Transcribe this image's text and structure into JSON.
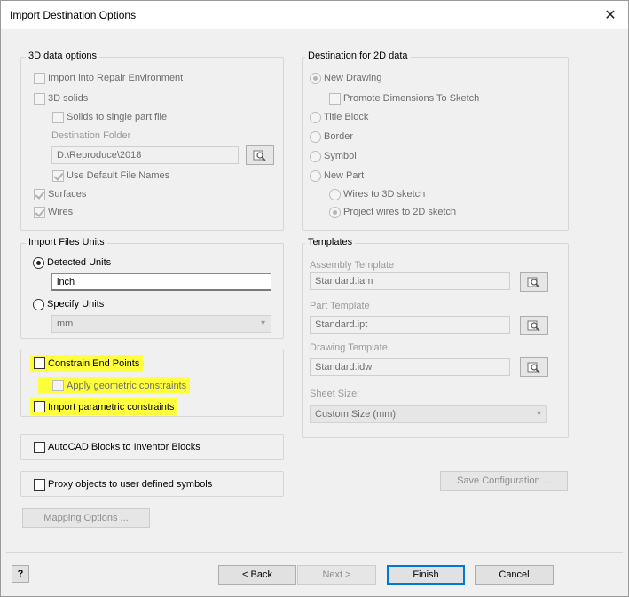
{
  "window": {
    "title": "Import Destination Options",
    "close_glyph": "✕"
  },
  "data_3d": {
    "label": "3D data options",
    "import_repair": "Import into Repair Environment",
    "solids_3d": "3D solids",
    "solids_single": "Solids to single part file",
    "dest_folder_label": "Destination Folder",
    "dest_folder_value": "D:\\Reproduce\\2018",
    "use_default_names": "Use Default File Names",
    "surfaces": "Surfaces",
    "wires": "Wires"
  },
  "dest_2d": {
    "label": "Destination for 2D data",
    "new_drawing": "New Drawing",
    "promote_dims": "Promote Dimensions To Sketch",
    "title_block": "Title Block",
    "border": "Border",
    "symbol": "Symbol",
    "new_part": "New Part",
    "wires_3d": "Wires to 3D sketch",
    "project_2d": "Project wires to 2D sketch"
  },
  "units": {
    "label": "Import Files Units",
    "detected": "Detected Units",
    "detected_value": "inch",
    "specify": "Specify Units",
    "specify_value": "mm"
  },
  "constraints": {
    "end_points": "Constrain End Points",
    "geometric": "Apply geometric constraints",
    "parametric": "Import parametric constraints"
  },
  "autocad_blocks": "AutoCAD Blocks to Inventor Blocks",
  "proxy_objects": "Proxy objects to user defined symbols",
  "mapping_button": "Mapping Options ...",
  "templates": {
    "label": "Templates",
    "assembly_label": "Assembly Template",
    "assembly_value": "Standard.iam",
    "part_label": "Part Template",
    "part_value": "Standard.ipt",
    "drawing_label": "Drawing Template",
    "drawing_value": "Standard.idw",
    "sheet_label": "Sheet Size:",
    "sheet_value": "Custom Size (mm)"
  },
  "save_config_button": "Save Configuration ...",
  "footer": {
    "help_glyph": "?",
    "back": "< Back",
    "next": "Next >",
    "finish": "Finish",
    "cancel": "Cancel"
  },
  "colors": {
    "highlight": "#ffff3e",
    "default_button_border": "#0078d7",
    "dialog_bg": "#f0f0f0"
  }
}
